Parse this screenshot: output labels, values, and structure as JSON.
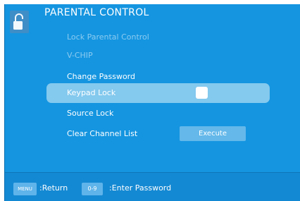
{
  "header": {
    "title": "PARENTAL CONTROL",
    "icon": "padlock-icon"
  },
  "menu": {
    "items": [
      {
        "label": "Lock Parental Control",
        "state": "disabled"
      },
      {
        "label": "V-CHIP",
        "state": "disabled"
      },
      {
        "label": "Change Password",
        "state": "normal"
      },
      {
        "label": "Keypad Lock",
        "state": "selected",
        "control": "toggle-off"
      },
      {
        "label": "Source Lock",
        "state": "normal"
      },
      {
        "label": "Clear Channel List",
        "state": "normal",
        "button_label": "Execute"
      }
    ]
  },
  "footer": {
    "menu_key": "MENU",
    "menu_hint": ":Return",
    "number_key": "0-9",
    "number_hint": ":Enter Password"
  },
  "colors": {
    "panel": "#1595e0",
    "selected_row": "#84c9ee",
    "footer": "#1489d3",
    "key_button": "#5fb4ea",
    "disabled_text": "#8ccbf0"
  }
}
